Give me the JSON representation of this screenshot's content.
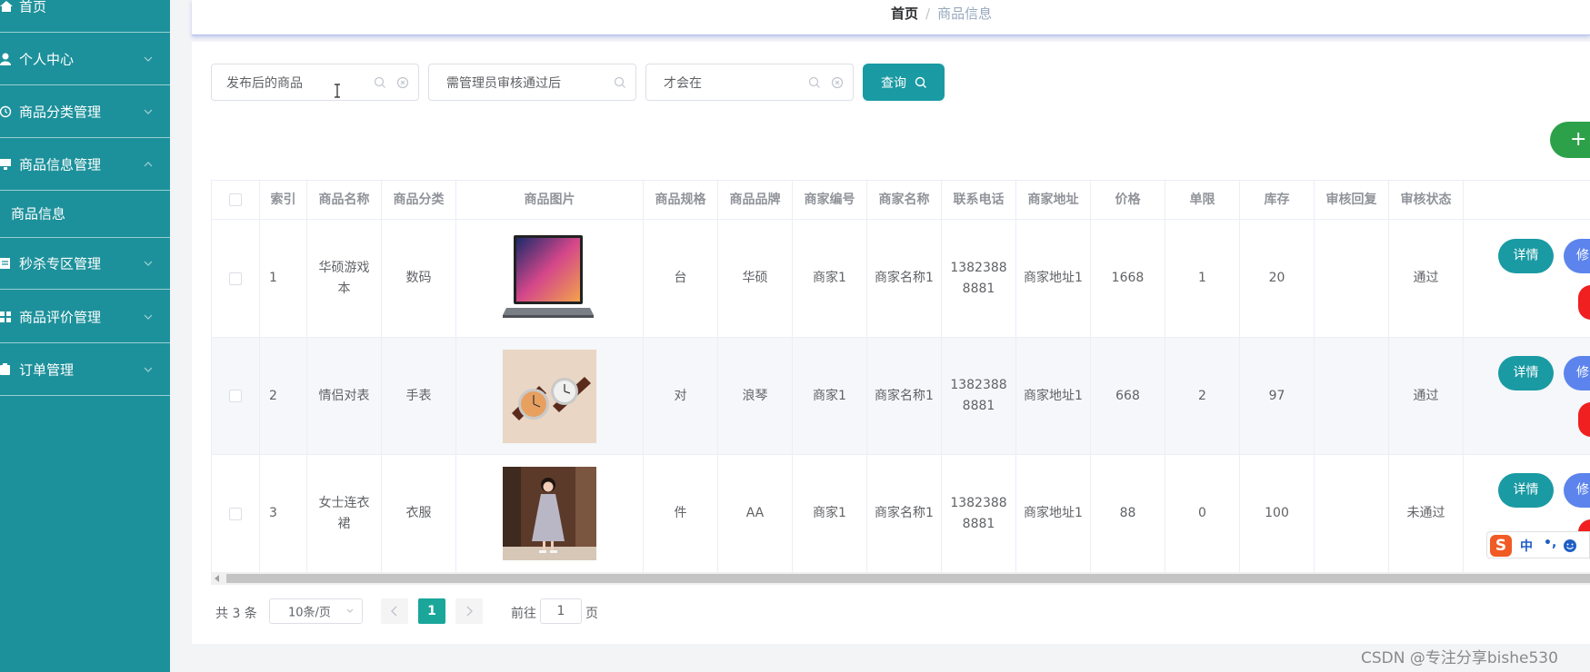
{
  "sidebar": {
    "items": [
      {
        "label": "首页",
        "icon": "home-icon",
        "has_arrow": false
      },
      {
        "label": "个人中心",
        "icon": "user-icon",
        "has_arrow": true
      },
      {
        "label": "商品分类管理",
        "icon": "clock-icon",
        "has_arrow": true
      },
      {
        "label": "商品信息管理",
        "icon": "monitor-icon",
        "has_arrow": true,
        "expanded": true
      },
      {
        "label": "秒杀专区管理",
        "icon": "document-icon",
        "has_arrow": true
      },
      {
        "label": "商品评价管理",
        "icon": "grid-icon",
        "has_arrow": true
      },
      {
        "label": "订单管理",
        "icon": "clipboard-icon",
        "has_arrow": true
      }
    ],
    "sub_item": "商品信息"
  },
  "breadcrumb": {
    "home": "首页",
    "separator": "/",
    "current": "商品信息"
  },
  "search": {
    "field1": "发布后的商品",
    "field2": "需管理员审核通过后",
    "field3": "才会在",
    "query_label": "查询"
  },
  "add_button": "+",
  "table": {
    "headers": [
      "索引",
      "商品名称",
      "商品分类",
      "商品图片",
      "商品规格",
      "商品品牌",
      "商家编号",
      "商家名称",
      "联系电话",
      "商家地址",
      "价格",
      "单限",
      "库存",
      "审核回复",
      "审核状态"
    ],
    "rows": [
      {
        "index": "1",
        "name": "华硕游戏本",
        "category": "数码",
        "image": "laptop-image",
        "spec": "台",
        "brand": "华硕",
        "merchant_no": "商家1",
        "merchant_name": "商家名称1",
        "phone": "13823888881",
        "address": "商家地址1",
        "price": "1668",
        "limit": "1",
        "stock": "20",
        "reply": "",
        "status": "通过"
      },
      {
        "index": "2",
        "name": "情侣对表",
        "category": "手表",
        "image": "watch-image",
        "spec": "对",
        "brand": "浪琴",
        "merchant_no": "商家1",
        "merchant_name": "商家名称1",
        "phone": "13823888881",
        "address": "商家地址1",
        "price": "668",
        "limit": "2",
        "stock": "97",
        "reply": "",
        "status": "通过"
      },
      {
        "index": "3",
        "name": "女士连衣裙",
        "category": "衣服",
        "image": "dress-image",
        "spec": "件",
        "brand": "AA",
        "merchant_no": "商家1",
        "merchant_name": "商家名称1",
        "phone": "13823888881",
        "address": "商家地址1",
        "price": "88",
        "limit": "0",
        "stock": "100",
        "reply": "",
        "status": "未通过"
      }
    ],
    "actions": {
      "detail": "详情",
      "edit": "修"
    }
  },
  "pagination": {
    "total": "共 3 条",
    "page_size": "10条/页",
    "current_page": "1",
    "goto_prefix": "前往",
    "goto_value": "1",
    "goto_suffix": "页"
  },
  "ime": {
    "logo": "S",
    "lang": "中",
    "punct": "•,"
  },
  "watermark": "CSDN @专注分享bishe530",
  "colors": {
    "sidebar": "#1d919b",
    "primary": "#1a9aa3",
    "add": "#2da14a",
    "edit": "#5c84ec",
    "delete": "#f02020",
    "page_active": "#1aa79a"
  }
}
